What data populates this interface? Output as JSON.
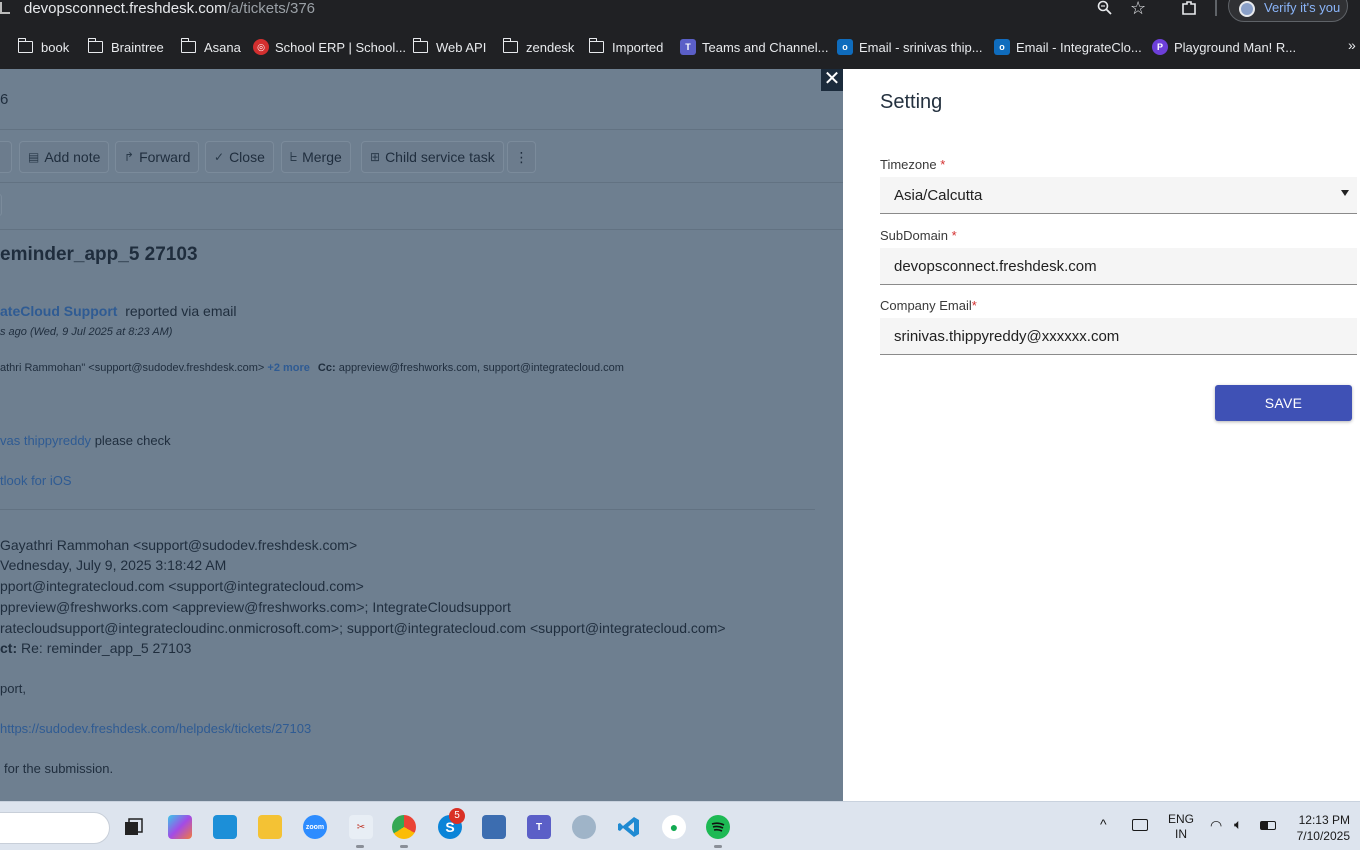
{
  "browser": {
    "url_host": "devopsconnect.freshdesk.com",
    "url_path": "/a/tickets/376",
    "profile_label": "Verify it's you",
    "bookmarks": [
      {
        "label": "book",
        "icon": "folder-icon"
      },
      {
        "label": "Braintree",
        "icon": "folder-icon"
      },
      {
        "label": "Asana",
        "icon": "folder-icon"
      },
      {
        "label": "School ERP | School...",
        "icon": "school-erp-favicon"
      },
      {
        "label": "Web API",
        "icon": "folder-icon"
      },
      {
        "label": "zendesk",
        "icon": "folder-icon"
      },
      {
        "label": "Imported",
        "icon": "folder-icon"
      },
      {
        "label": "Teams and Channel...",
        "icon": "teams-favicon"
      },
      {
        "label": "Email - srinivas thip...",
        "icon": "outlook-favicon"
      },
      {
        "label": "Email - IntegrateClo...",
        "icon": "outlook-favicon"
      },
      {
        "label": "Playground Man! R...",
        "icon": "playground-favicon"
      }
    ],
    "bookmarks_overflow": "»"
  },
  "ticket": {
    "number_fragment": "6",
    "toolbar": {
      "add_note": "Add note",
      "forward": "Forward",
      "close": "Close",
      "merge": "Merge",
      "child_service_task": "Child service task",
      "more": "⋮"
    },
    "subject": "eminder_app_5 27103",
    "reporter_name": "ateCloud Support",
    "reporter_suffix": "reported via email",
    "time": "s ago (Wed, 9 Jul 2025 at 8:23 AM)",
    "to_line": "athri Rammohan\" <support@sudodev.freshdesk.com>",
    "to_more": "+2 more",
    "cc_label": "Cc:",
    "cc_value": "appreview@freshworks.com, support@integratecloud.com",
    "mention": "vas thippyreddy",
    "mention_suffix": "please check",
    "outlook": "tlook for iOS",
    "mail_lines": [
      {
        "bold": "",
        "text": "Gayathri Rammohan <support@sudodev.freshdesk.com>"
      },
      {
        "bold": "",
        "text": "Vednesday, July 9, 2025 3:18:42 AM"
      },
      {
        "bold": "",
        "text": "pport@integratecloud.com <support@integratecloud.com>"
      },
      {
        "bold": "",
        "text": "ppreview@freshworks.com <appreview@freshworks.com>; IntegrateCloudsupport"
      },
      {
        "bold": "",
        "text": "ratecloudsupport@integratecloudinc.onmicrosoft.com>; support@integratecloud.com <support@integratecloud.com>"
      },
      {
        "bold": "ct:",
        "text": " Re: reminder_app_5 27103"
      },
      {
        "bold": "",
        "text": "port,"
      }
    ],
    "link": " https://sudodev.freshdesk.com/helpdesk/tickets/27103",
    "closing": "for the submission."
  },
  "settings": {
    "title": "Setting",
    "timezone_label": "Timezone",
    "timezone_value": "Asia/Calcutta",
    "subdomain_label": "SubDomain",
    "subdomain_value": "devopsconnect.freshdesk.com",
    "email_label": "Company Email",
    "email_value": "srinivas.thippyreddy@xxxxxx.com",
    "required_mark": "*",
    "save_label": "SAVE",
    "close_label": "✕"
  },
  "taskbar": {
    "skype_badge": "5",
    "lang_line1": "ENG",
    "lang_line2": "IN",
    "time": "12:13 PM",
    "date": "7/10/2025"
  },
  "colors": {
    "accent": "#3f51b5",
    "overlay": "#6e7f90",
    "link": "#2f5b93"
  }
}
